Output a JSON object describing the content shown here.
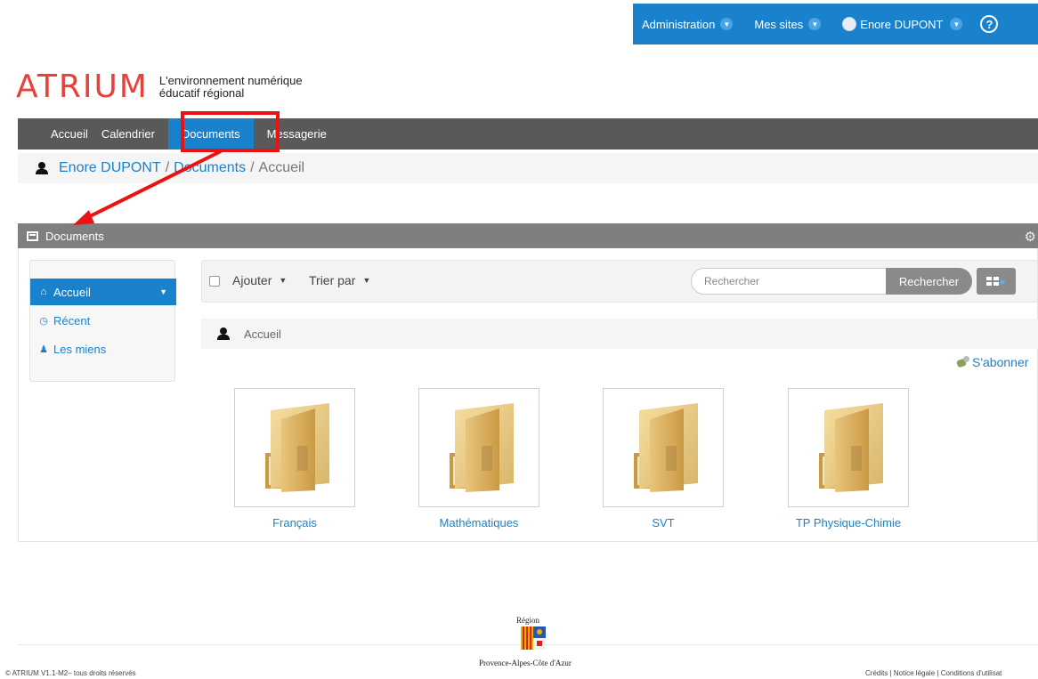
{
  "topbar": {
    "administration": "Administration",
    "sites": "Mes sites",
    "user": "Enore DUPONT",
    "help": "?"
  },
  "logo": {
    "name": "ATRIUM",
    "tagline_line1": "L'environnement numérique",
    "tagline_line2": "éducatif régional"
  },
  "nav": {
    "items": [
      {
        "label": "Accueil"
      },
      {
        "label": "Calendrier"
      },
      {
        "label": "Documents",
        "active": true
      },
      {
        "label": "Messagerie"
      }
    ]
  },
  "breadcrumb": {
    "user": "Enore DUPONT",
    "sep": "/",
    "section": "Documents",
    "page": "Accueil"
  },
  "portlet": {
    "title": "Documents"
  },
  "sidemenu": {
    "items": [
      {
        "label": "Accueil",
        "icon": "home-icon",
        "active": true
      },
      {
        "label": "Récent",
        "icon": "clock-icon"
      },
      {
        "label": "Les miens",
        "icon": "user-icon"
      }
    ]
  },
  "toolbar": {
    "add": "Ajouter",
    "sort": "Trier par",
    "search_placeholder": "Rechercher",
    "search_button": "Rechercher"
  },
  "folderbar": {
    "label": "Accueil"
  },
  "subscribe": "S'abonner",
  "folders": [
    {
      "name": "Français"
    },
    {
      "name": "Mathématiques"
    },
    {
      "name": "SVT"
    },
    {
      "name": "TP Physique-Chimie"
    }
  ],
  "footer": {
    "region_title": "Région",
    "region_name": "Provence-Alpes-Côte d'Azur",
    "copyright": "© ATRIUM V1.1-M2– tous droits réservés",
    "links": [
      "Crédits",
      "Notice légale",
      "Conditions d'utilisat"
    ],
    "link_sep": "|"
  },
  "colors": {
    "brand_blue": "#1a82cc",
    "logo_red": "#e8413a",
    "nav_gray": "#595959",
    "highlight_red": "#ee1111"
  }
}
